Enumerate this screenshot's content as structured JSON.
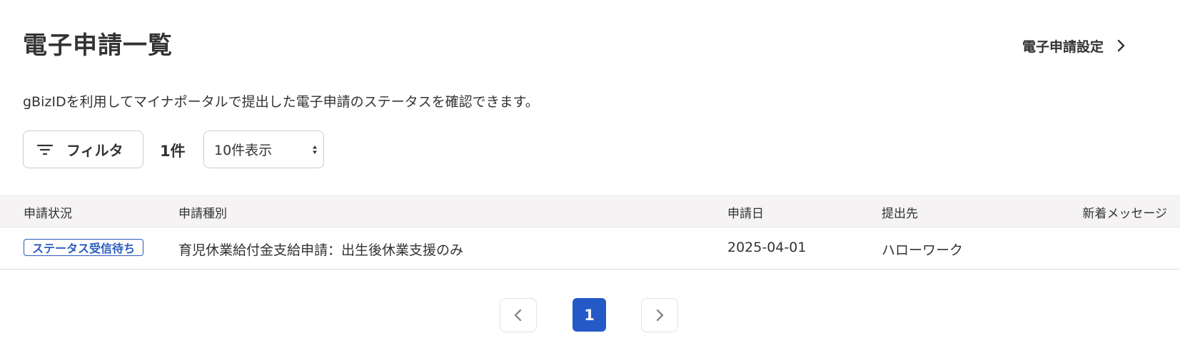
{
  "header": {
    "title": "電子申請一覧",
    "settings_link": "電子申請設定"
  },
  "description": "gBizIDを利用してマイナポータルで提出した電子申請のステータスを確認できます。",
  "toolbar": {
    "filter_label": "フィルタ",
    "count": "1件",
    "per_page_selected": "10件表示"
  },
  "table": {
    "columns": [
      "申請状況",
      "申請種別",
      "申請日",
      "提出先",
      "新着メッセージ"
    ],
    "rows": [
      {
        "status": "ステータス受信待ち",
        "type": "育児休業給付金支給申請：出生後休業支援のみ",
        "date": "2025-04-01",
        "destination": "ハローワーク",
        "new_message": ""
      }
    ]
  },
  "pagination": {
    "current_page": "1"
  },
  "colors": {
    "accent": "#2559c8",
    "badge": "#2b5cbf",
    "header_bg": "#f5f3f3",
    "text": "#333333"
  },
  "icons": {
    "settings_arrow": "chevron-right-icon",
    "filter": "filter-icon",
    "select_caret": "sort-caret-icon",
    "prev": "chevron-left-icon",
    "next": "chevron-right-icon"
  }
}
